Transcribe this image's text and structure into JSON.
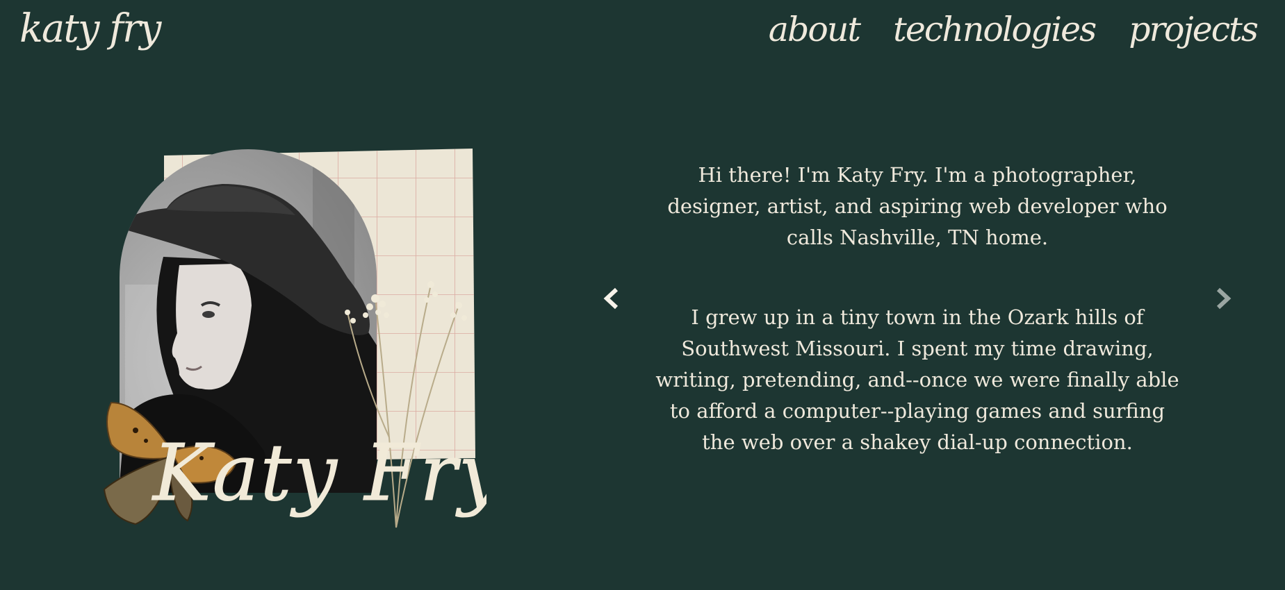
{
  "header": {
    "logo_text": "katy fry",
    "nav": [
      "about",
      "technologies",
      "projects"
    ]
  },
  "portrait": {
    "signature": "Katy Fry"
  },
  "carousel": {
    "paragraphs": [
      "Hi there! I'm Katy Fry. I'm a photographer, designer, artist, and aspiring web developer who calls Nashville, TN home.",
      "I grew up in a tiny town in the Ozark hills of Southwest Missouri. I spent my time drawing, writing, pretending, and--once we were finally able to afford a computer--playing games and surfing the web over a shakey dial-up connection."
    ],
    "prev_icon": "chevron-left-icon",
    "next_icon": "chevron-right-icon"
  },
  "colors": {
    "background": "#1d3632",
    "text": "#efe9dc",
    "paper": "#ece6d6",
    "grid": "#d9a39a"
  }
}
